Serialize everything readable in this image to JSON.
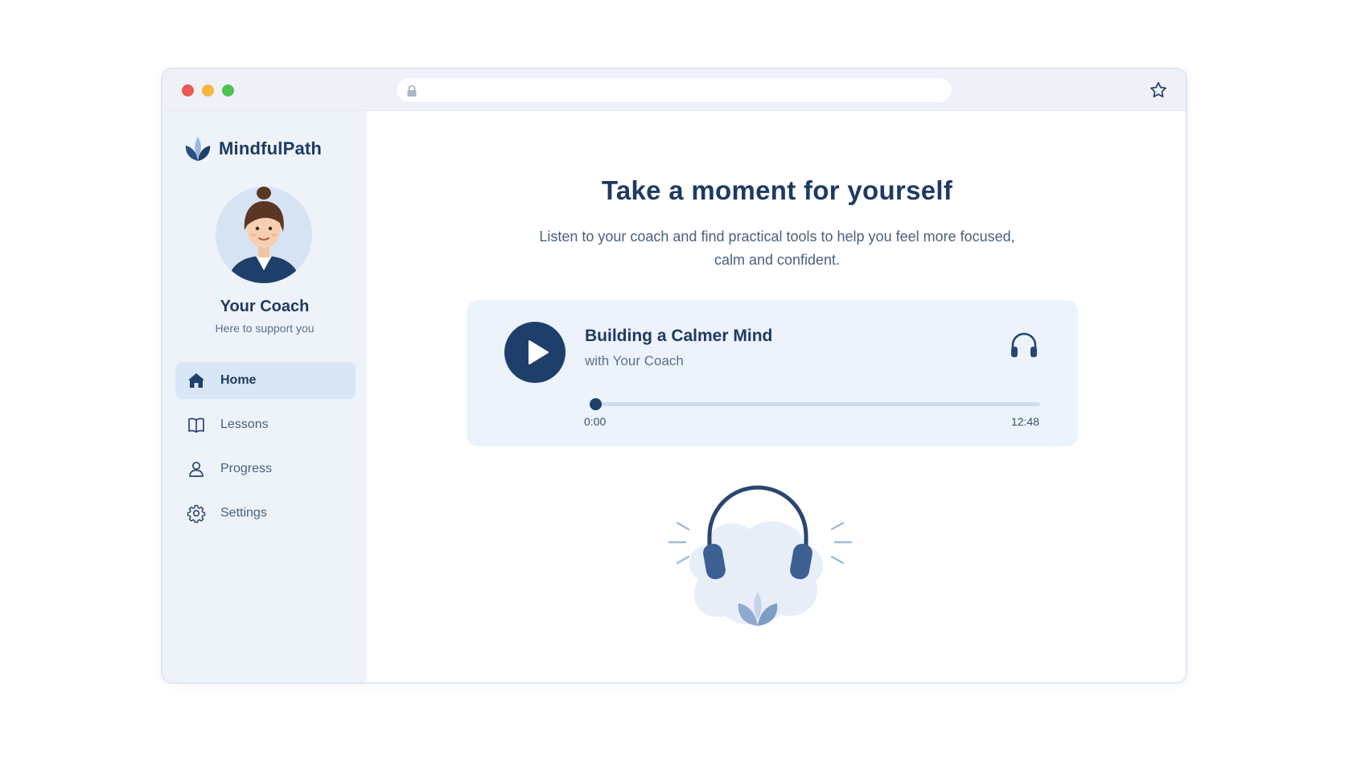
{
  "app": {
    "brand_name": "MindfulPath",
    "colors": {
      "primary": "#1f3f6b",
      "sidebar_bg": "#eef3fa",
      "card_bg": "#edf3fb",
      "active_nav_bg": "#d9e6f6"
    }
  },
  "browser": {
    "url": "",
    "icons": [
      "lock-icon",
      "star-icon"
    ]
  },
  "sidebar": {
    "coach": {
      "name": "Your Coach",
      "subtitle": "Here to support you"
    },
    "items": [
      {
        "label": "Home",
        "icon": "home-icon",
        "active": true
      },
      {
        "label": "Lessons",
        "icon": "book-icon",
        "active": false
      },
      {
        "label": "Progress",
        "icon": "user-icon",
        "active": false
      },
      {
        "label": "Settings",
        "icon": "gear-icon",
        "active": false
      }
    ]
  },
  "main": {
    "headline": "Take a moment for yourself",
    "subtext": "Listen to your coach and find practical tools to help you feel more focused, calm and confident.",
    "player": {
      "title": "Building a Calmer Mind",
      "subtitle": "with Your Coach",
      "current_time": "0:00",
      "duration": "12:48",
      "progress_fraction": 0.0
    }
  }
}
